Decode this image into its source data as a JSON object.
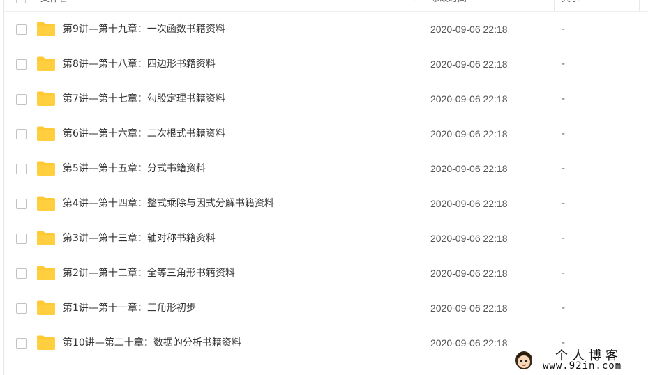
{
  "header": {
    "name_label": "文件名",
    "mtime_label": "修改时间",
    "size_label": "大小"
  },
  "files": [
    {
      "name": "第9讲—第十九章：一次函数书籍资料",
      "mtime": "2020-09-06 22:18",
      "size": "-"
    },
    {
      "name": "第8讲—第十八章：四边形书籍资料",
      "mtime": "2020-09-06 22:18",
      "size": "-"
    },
    {
      "name": "第7讲—第十七章：勾股定理书籍资料",
      "mtime": "2020-09-06 22:18",
      "size": "-"
    },
    {
      "name": "第6讲—第十六章：二次根式书籍资料",
      "mtime": "2020-09-06 22:18",
      "size": "-"
    },
    {
      "name": "第5讲—第十五章：分式书籍资料",
      "mtime": "2020-09-06 22:18",
      "size": "-"
    },
    {
      "name": "第4讲—第十四章：整式乘除与因式分解书籍资料",
      "mtime": "2020-09-06 22:18",
      "size": "-"
    },
    {
      "name": "第3讲—第十三章：轴对称书籍资料",
      "mtime": "2020-09-06 22:18",
      "size": "-"
    },
    {
      "name": "第2讲—第十二章：全等三角形书籍资料",
      "mtime": "2020-09-06 22:18",
      "size": "-"
    },
    {
      "name": "第1讲—第十一章：三角形初步",
      "mtime": "2020-09-06 22:18",
      "size": "-"
    },
    {
      "name": "第10讲—第二十章：数据的分析书籍资料",
      "mtime": "2020-09-06 22:18",
      "size": "-"
    }
  ],
  "watermark": {
    "title": "个人博客",
    "url": "www.92in.com"
  },
  "icons": {
    "folder": "folder-icon",
    "sort": "sort-arrow-icon",
    "checkbox": "checkbox"
  },
  "colors": {
    "folder_yellow": "#ffc933",
    "sort_blue": "#3b8cff",
    "text": "#333333"
  }
}
